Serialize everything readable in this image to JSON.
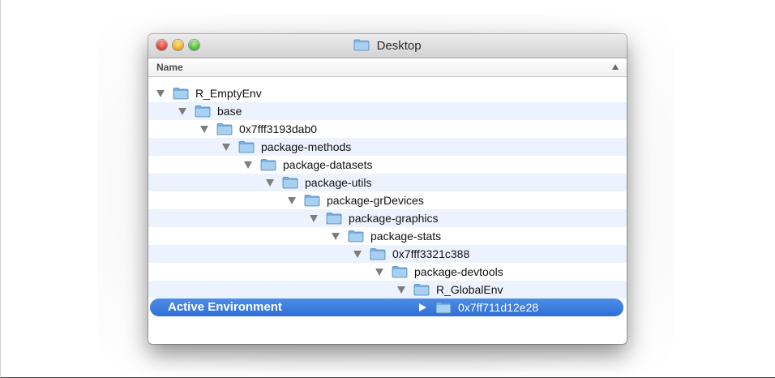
{
  "window": {
    "title": "Desktop",
    "title_icon": "folder-icon"
  },
  "list_header": {
    "column_name": "Name",
    "sort_icon": "sort-ascending-icon"
  },
  "rows": [
    {
      "label": "R_EmptyEnv",
      "depth": 0,
      "expanded": true
    },
    {
      "label": "base",
      "depth": 1,
      "expanded": true
    },
    {
      "label": "0x7fff3193dab0",
      "depth": 2,
      "expanded": true
    },
    {
      "label": "package-methods",
      "depth": 3,
      "expanded": true
    },
    {
      "label": "package-datasets",
      "depth": 4,
      "expanded": true
    },
    {
      "label": "package-utils",
      "depth": 5,
      "expanded": true
    },
    {
      "label": "package-grDevices",
      "depth": 6,
      "expanded": true
    },
    {
      "label": "package-graphics",
      "depth": 7,
      "expanded": true
    },
    {
      "label": "package-stats",
      "depth": 8,
      "expanded": true
    },
    {
      "label": "0x7fff3321c388",
      "depth": 9,
      "expanded": true
    },
    {
      "label": "package-devtools",
      "depth": 10,
      "expanded": true
    },
    {
      "label": "R_GlobalEnv",
      "depth": 11,
      "expanded": true
    },
    {
      "label": "0x7ff711d12e28",
      "depth": 12,
      "expanded": false,
      "selected": true
    }
  ],
  "annotation": {
    "text": "Active Environment"
  },
  "colors": {
    "selection": "#3a7ce0",
    "alt_row": "#edf3fe",
    "folder": "#8fc2ec"
  }
}
